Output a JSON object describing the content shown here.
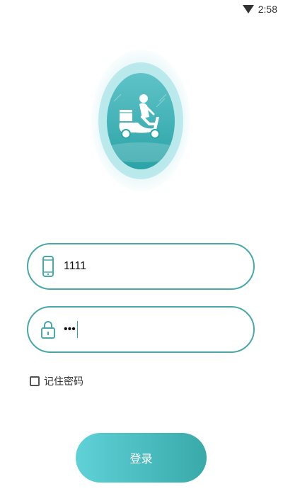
{
  "status_bar": {
    "time": "2:58",
    "icons": [
      "wifi-icon"
    ]
  },
  "logo": {
    "icon": "delivery-scooter-icon",
    "colors": {
      "circle_top": "#5fc3c8",
      "circle_bottom": "#2aa3a7",
      "ring": "#91dce1"
    }
  },
  "form": {
    "phone": {
      "icon": "phone-icon",
      "value": "1111"
    },
    "password": {
      "icon": "lock-icon",
      "masked_value": "•••"
    },
    "remember": {
      "label": "记住密码",
      "checked": false
    },
    "login_button": {
      "label": "登录"
    }
  },
  "colors": {
    "accent": "#4aa8a8",
    "button_start": "#5fd2d8",
    "button_end": "#39a9a9"
  }
}
